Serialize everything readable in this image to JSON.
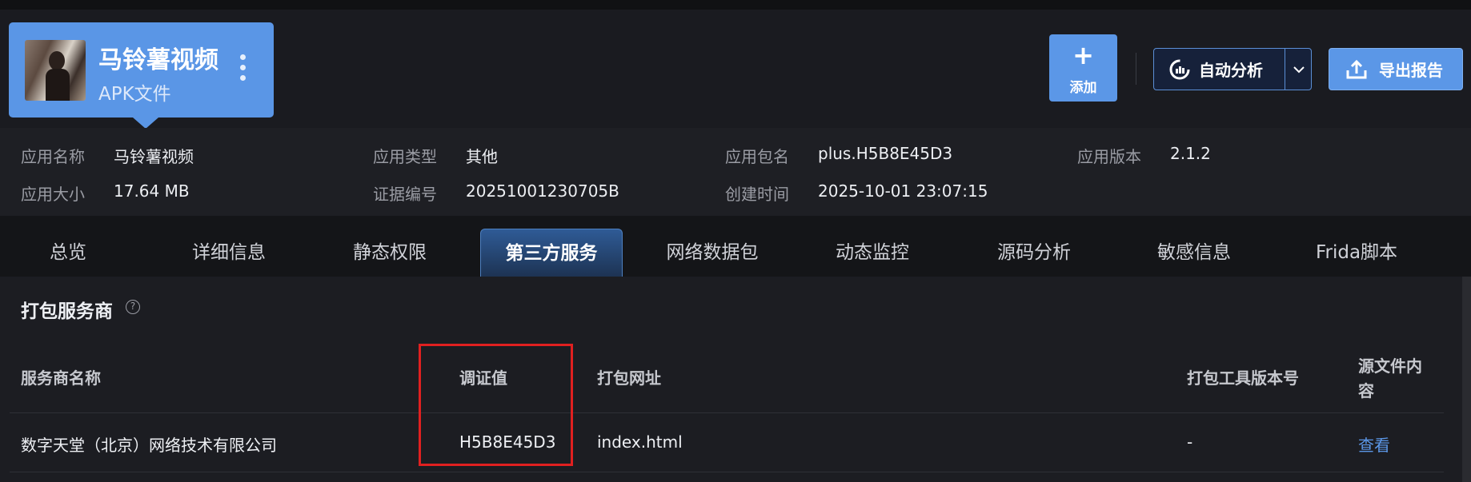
{
  "app": {
    "name": "马铃薯视频",
    "file_type": "APK文件"
  },
  "actions": {
    "add_plus": "+",
    "add_label": "添加",
    "auto_analyze_label": "自动分析",
    "export_label": "导出报告"
  },
  "info": [
    {
      "key": "应用名称",
      "value": "马铃薯视频"
    },
    {
      "key": "应用类型",
      "value": "其他"
    },
    {
      "key": "应用包名",
      "value": "plus.H5B8E45D3"
    },
    {
      "key": "应用版本",
      "value": "2.1.2"
    },
    {
      "key": "应用大小",
      "value": "17.64 MB"
    },
    {
      "key": "证据编号",
      "value": "20251001230705B"
    },
    {
      "key": "创建时间",
      "value": "2025-10-01 23:07:15"
    }
  ],
  "tabs": [
    {
      "label": "总览",
      "active": false
    },
    {
      "label": "详细信息",
      "active": false
    },
    {
      "label": "静态权限",
      "active": false
    },
    {
      "label": "第三方服务",
      "active": true
    },
    {
      "label": "网络数据包",
      "active": false
    },
    {
      "label": "动态监控",
      "active": false
    },
    {
      "label": "源码分析",
      "active": false
    },
    {
      "label": "敏感信息",
      "active": false
    },
    {
      "label": "Frida脚本",
      "active": false
    }
  ],
  "section": {
    "title": "打包服务商",
    "help_icon": "question-circle-icon"
  },
  "table": {
    "headers": [
      "服务商名称",
      "调证值",
      "打包网址",
      "打包工具版本号",
      "源文件内",
      "容"
    ],
    "rows": [
      {
        "provider": "数字天堂（北京）网络技术有限公司",
        "evidence_value": "H5B8E45D3",
        "url": "index.html",
        "tool_version": "-",
        "source_file": "查看"
      }
    ]
  },
  "colors": {
    "accent": "#5b97e7",
    "highlight_box": "#e02020",
    "background": "#1c1d22"
  }
}
